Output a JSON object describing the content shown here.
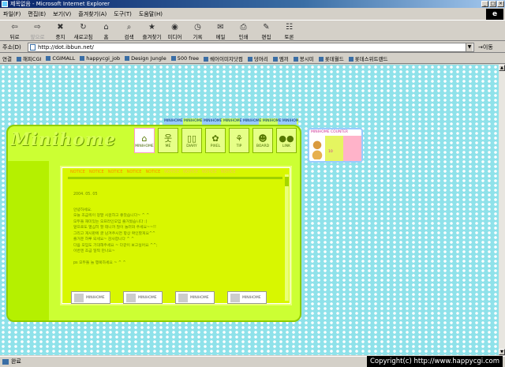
{
  "window": {
    "title": "제목없음 - Microsoft Internet Explorer",
    "controls": [
      "_",
      "□",
      "×"
    ]
  },
  "menu": [
    "파일(F)",
    "편집(E)",
    "보기(V)",
    "즐겨찾기(A)",
    "도구(T)",
    "도움말(H)"
  ],
  "toolbar": [
    {
      "label": "뒤로",
      "icon": "back-arrow-icon",
      "glyph": "⇦",
      "disabled": false
    },
    {
      "label": "앞으로",
      "icon": "forward-arrow-icon",
      "glyph": "⇨",
      "disabled": true
    },
    {
      "label": "중지",
      "icon": "stop-icon",
      "glyph": "✖",
      "disabled": false
    },
    {
      "label": "새로고침",
      "icon": "refresh-icon",
      "glyph": "↻",
      "disabled": false
    },
    {
      "label": "홈",
      "icon": "home-icon",
      "glyph": "⌂",
      "disabled": false
    },
    {
      "label": "검색",
      "icon": "search-icon",
      "glyph": "⌕",
      "disabled": false
    },
    {
      "label": "즐겨찾기",
      "icon": "favorites-icon",
      "glyph": "★",
      "disabled": false
    },
    {
      "label": "미디어",
      "icon": "media-icon",
      "glyph": "◉",
      "disabled": false
    },
    {
      "label": "기록",
      "icon": "history-icon",
      "glyph": "◷",
      "disabled": false
    },
    {
      "label": "메일",
      "icon": "mail-icon",
      "glyph": "✉",
      "disabled": false
    },
    {
      "label": "인쇄",
      "icon": "print-icon",
      "glyph": "⎙",
      "disabled": false
    },
    {
      "label": "편집",
      "icon": "edit-icon",
      "glyph": "✎",
      "disabled": false
    },
    {
      "label": "토론",
      "icon": "discuss-icon",
      "glyph": "☷",
      "disabled": false
    }
  ],
  "address": {
    "label": "주소(D)",
    "url": "http://dot.ibbun.net/",
    "go_label": "이동"
  },
  "links": {
    "label": "연결",
    "items": [
      "해피CGI",
      "CGIMALL",
      "happycgi_job",
      "Design Jungle",
      "500 free",
      "쉐어이미지닷컴",
      "덩머리",
      "엠끼",
      "봉시미",
      "롯데월드",
      "롯데스위트랜드"
    ]
  },
  "minihome": {
    "logo": "Minihome",
    "top_strip": "MINIHOME MINIHOME MINIHOME MINIHOME MINIHOME MINIHOME MINIHOME",
    "nav": [
      {
        "label": "MINIHOME",
        "glyph": "⌂"
      },
      {
        "label": "ME",
        "glyph": "웃"
      },
      {
        "label": "DIARY",
        "glyph": "▯▯"
      },
      {
        "label": "PIXEL",
        "glyph": "✿"
      },
      {
        "label": "TIP",
        "glyph": "⚘"
      },
      {
        "label": "BOARD",
        "glyph": "☻"
      },
      {
        "label": "LINK",
        "glyph": "●●"
      }
    ],
    "notices": [
      "NOTICE",
      "NOTICE",
      "NOTICE",
      "NOTICE",
      "NOTICE",
      "NOTICE",
      "NOTICE",
      "NOTICE",
      "NOTICE"
    ],
    "post_date": "2004. 05. 05",
    "post_lines": [
      "안녕하세요.",
      "오늘 조금씩이 정말 시원하고 좋았습니다~ ^ ^",
      "모두들 재미있는 오프라인모임 즐거웠습니다 :)",
      "앞으로도 열심히 할 테니까 많이 놀러와 주세요~~!!",
      "그리고 게시판에 글 남겨주시면 항상 확인할게요^^",
      "즐거운 하루 되세요~ 감사합니다 ^ ^",
      "다음 모임도 기대해주세요 ~ 다같이 보고싶어요 ^^;",
      "이번엔 조금 일찍 만나요~",
      "",
      "ps 모두들 늘 행복하세요 ~ ^ ^"
    ],
    "mini_banners": [
      "MINIHOME",
      "MINIHOME",
      "MINIHOME",
      "MINIHOME"
    ]
  },
  "counter": {
    "title": "MINIHOME COUNTER",
    "value": "10"
  },
  "status": {
    "text": "완료",
    "copyright": "Copyright(c) http://www.happycgi.com"
  }
}
